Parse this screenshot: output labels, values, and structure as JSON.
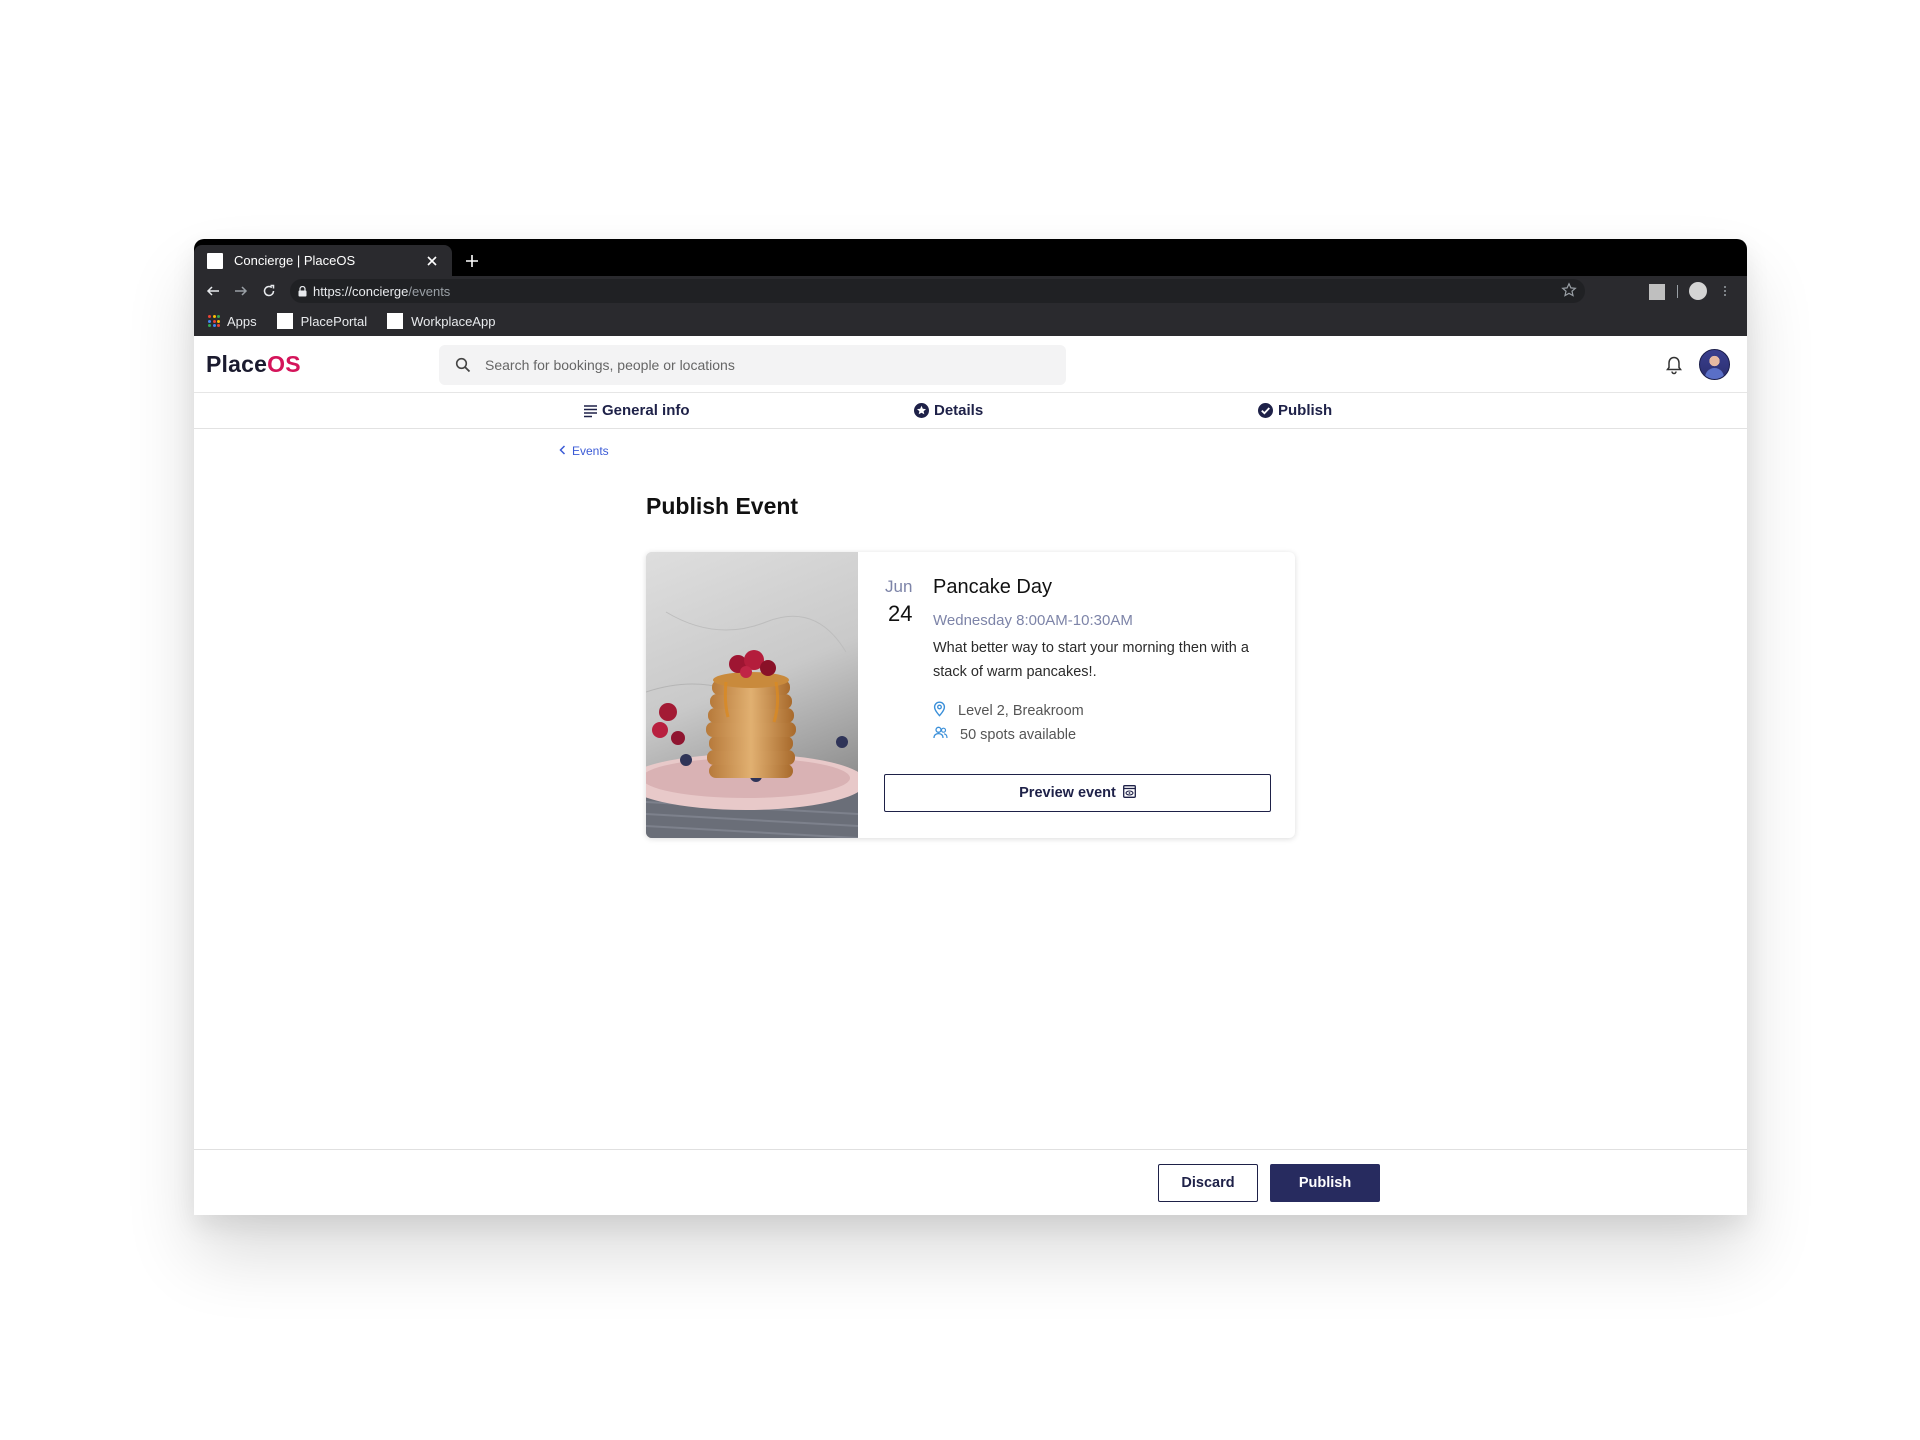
{
  "browser": {
    "tab_title": "Concierge | PlaceOS",
    "url_host": "https://concierge",
    "url_path": "/events",
    "bookmarks": [
      {
        "label": "Apps"
      },
      {
        "label": "PlacePortal"
      },
      {
        "label": "WorkplaceApp"
      }
    ]
  },
  "header": {
    "logo_primary": "Place",
    "logo_accent": "OS",
    "search_placeholder": "Search for bookings, people or locations"
  },
  "stepper": {
    "steps": [
      {
        "label": "General info",
        "icon": "list-icon"
      },
      {
        "label": "Details",
        "icon": "star-circle-icon"
      },
      {
        "label": "Publish",
        "icon": "check-circle-icon"
      }
    ]
  },
  "breadcrumb": {
    "label": "Events"
  },
  "page": {
    "title": "Publish Event"
  },
  "event": {
    "month": "Jun",
    "day": "24",
    "title": "Pancake Day",
    "time": "Wednesday 8:00AM-10:30AM",
    "description": "What better way to start your morning then with a stack of warm pancakes!.",
    "location": "Level 2, Breakroom",
    "spots": "50 spots available",
    "preview_label": "Preview event"
  },
  "footer": {
    "discard_label": "Discard",
    "publish_label": "Publish"
  },
  "colors": {
    "brand_accent": "#d4145a",
    "navy": "#1e2148",
    "primary_button": "#272b5f",
    "link": "#3b5bd6",
    "muted_date": "#7d84a8"
  }
}
